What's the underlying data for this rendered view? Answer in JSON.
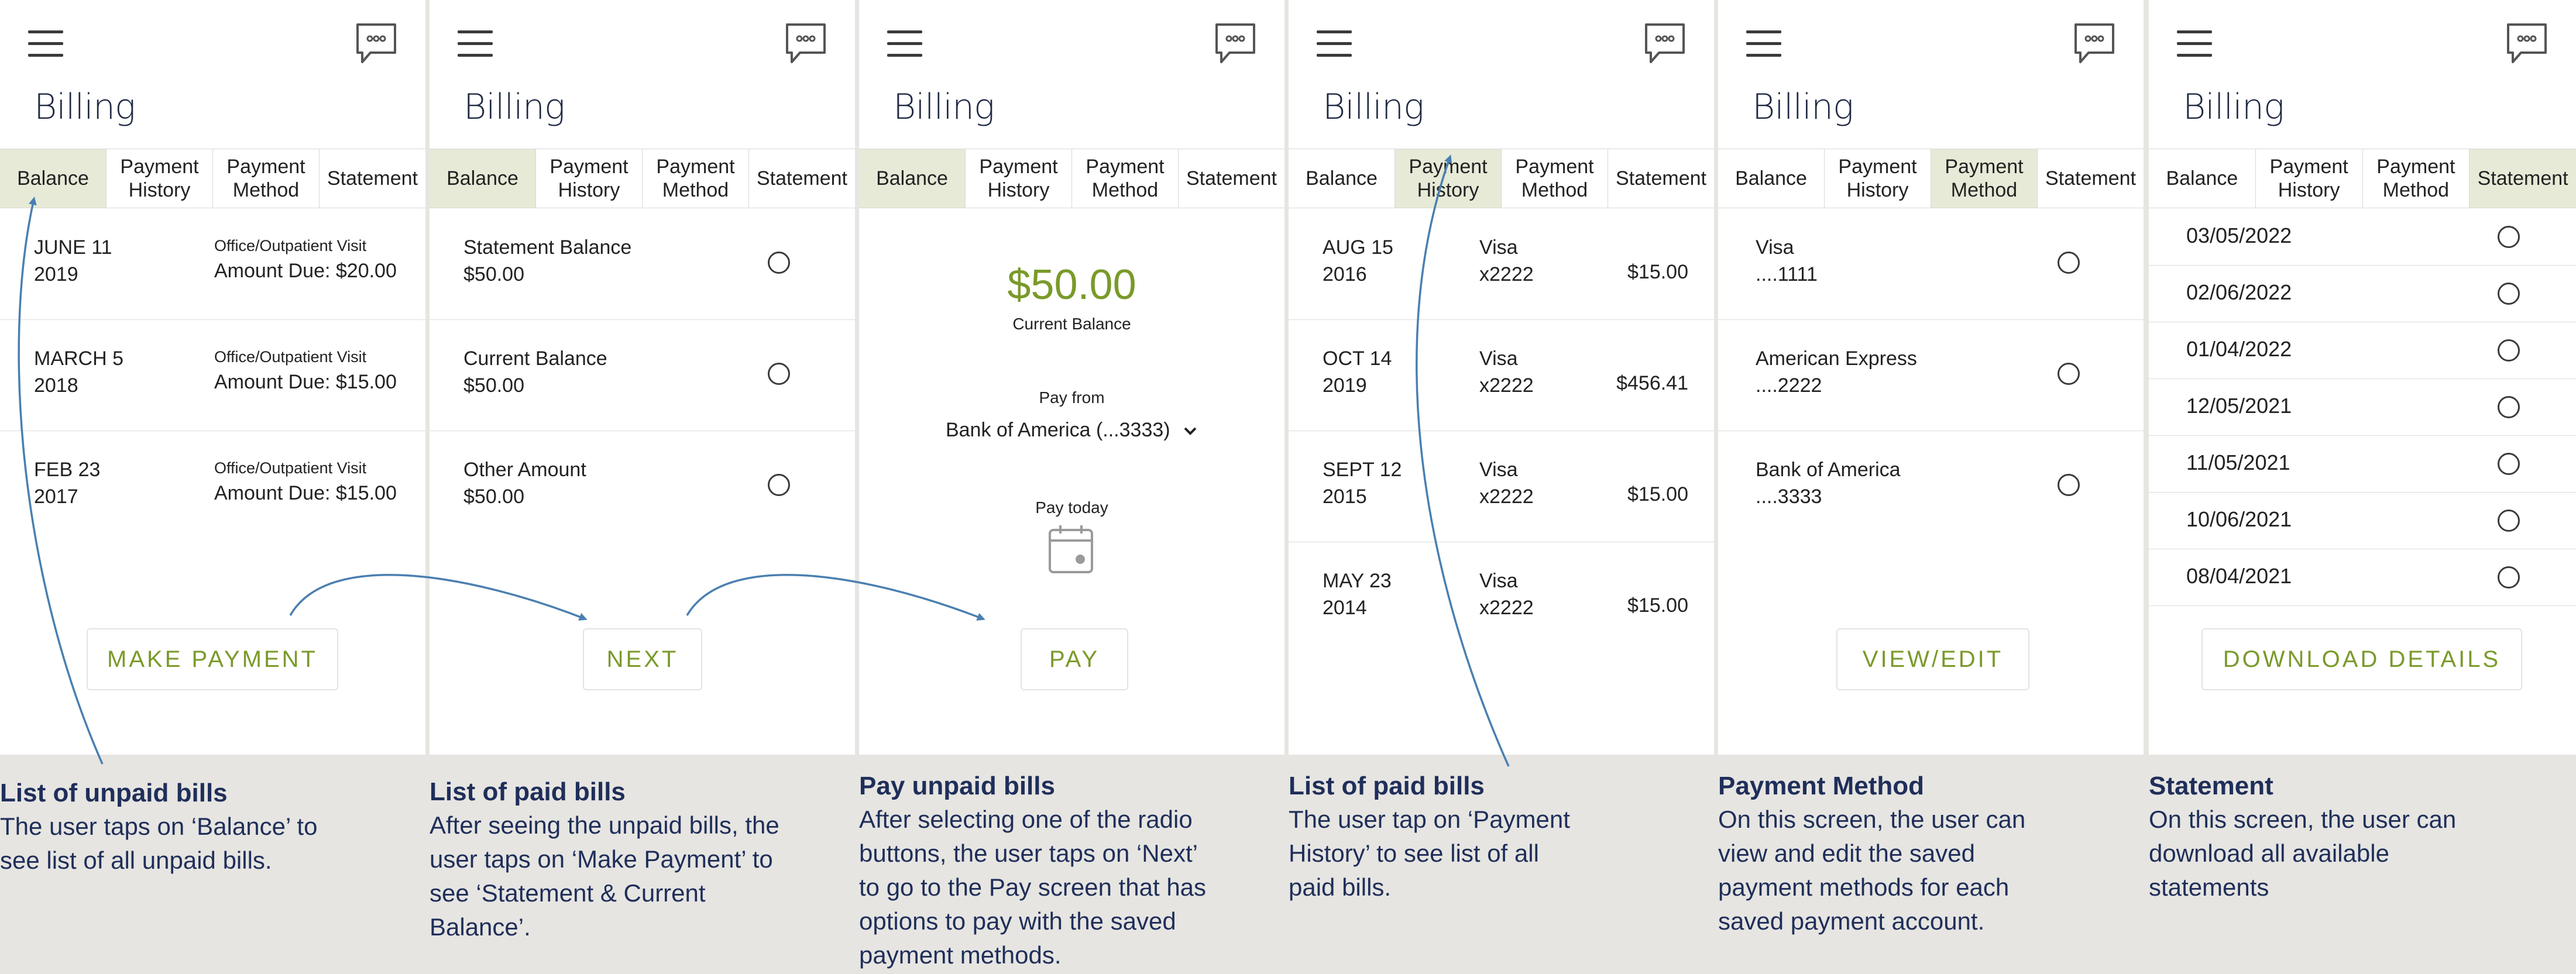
{
  "common": {
    "title": "Billing",
    "tabs": [
      "Balance",
      "Payment\nHistory",
      "Payment\nMethod",
      "Statement"
    ]
  },
  "icons": {
    "menu": "hamburger-menu-icon",
    "chat": "chat-bubble-icon",
    "calendar": "calendar-icon",
    "chevron": "chevron-down-icon"
  },
  "colors": {
    "accent": "#7a9a2a",
    "active_tab": "#e6ead7",
    "caption_bg": "#e6e5e1",
    "caption_text": "#1f2e5a",
    "arrow": "#4a7fb0"
  },
  "screen1": {
    "active_tab": 0,
    "bills": [
      {
        "date": "JUNE 11\n2019",
        "type": "Office/Outpatient Visit",
        "amount": "Amount Due: $20.00"
      },
      {
        "date": "MARCH 5\n2018",
        "type": "Office/Outpatient Visit",
        "amount": "Amount Due: $15.00"
      },
      {
        "date": "FEB 23\n2017",
        "type": "Office/Outpatient Visit",
        "amount": "Amount Due: $15.00"
      }
    ],
    "button": "MAKE PAYMENT"
  },
  "screen2": {
    "active_tab": 0,
    "options": [
      {
        "label": "Statement Balance",
        "value": "$50.00"
      },
      {
        "label": "Current Balance",
        "value": "$50.00"
      },
      {
        "label": "Other Amount",
        "value": "$50.00"
      }
    ],
    "button": "NEXT"
  },
  "screen3": {
    "active_tab": 0,
    "amount": "$50.00",
    "amount_label": "Current Balance",
    "pay_from_label": "Pay from",
    "pay_from_value": "Bank of America (...3333)",
    "pay_today_label": "Pay today",
    "button": "PAY"
  },
  "screen4": {
    "active_tab": 1,
    "payments": [
      {
        "date": "AUG 15\n2016",
        "card": "Visa\nx2222",
        "amount": "$15.00"
      },
      {
        "date": "OCT 14\n2019",
        "card": "Visa\nx2222",
        "amount": "$456.41"
      },
      {
        "date": "SEPT 12\n2015",
        "card": "Visa\nx2222",
        "amount": "$15.00"
      },
      {
        "date": "MAY 23\n2014",
        "card": "Visa\nx2222",
        "amount": "$15.00"
      }
    ]
  },
  "screen5": {
    "active_tab": 2,
    "methods": [
      {
        "name": "Visa",
        "number": "....1111"
      },
      {
        "name": "American Express",
        "number": "....2222"
      },
      {
        "name": "Bank of America",
        "number": "....3333"
      }
    ],
    "button": "VIEW/EDIT"
  },
  "screen6": {
    "active_tab": 3,
    "statements": [
      "03/05/2022",
      "02/06/2022",
      "01/04/2022",
      "12/05/2021",
      "11/05/2021",
      "10/06/2021",
      "08/04/2021"
    ],
    "button": "DOWNLOAD DETAILS"
  },
  "captions": [
    {
      "title": "List of unpaid bills",
      "body": "The user taps on ‘Balance’ to\nsee list of all unpaid bills."
    },
    {
      "title": "List of paid bills",
      "body": "After seeing the unpaid bills, the\nuser taps on ‘Make Payment’ to\nsee ‘Statement & Current\nBalance’."
    },
    {
      "title": "Pay unpaid bills",
      "body": "After selecting one of the radio\nbuttons, the user taps on ‘Next’\nto go to the Pay screen that has\noptions to pay with the saved\npayment methods."
    },
    {
      "title": "List of paid bills",
      "body": "The user tap on ‘Payment\nHistory’ to see list of all\npaid bills."
    },
    {
      "title": "Payment Method",
      "body": "On this screen, the user can\nview and edit the saved\npayment methods for each\nsaved payment account."
    },
    {
      "title": "Statement",
      "body": "On this screen, the user can\ndownload all available\nstatements"
    }
  ]
}
